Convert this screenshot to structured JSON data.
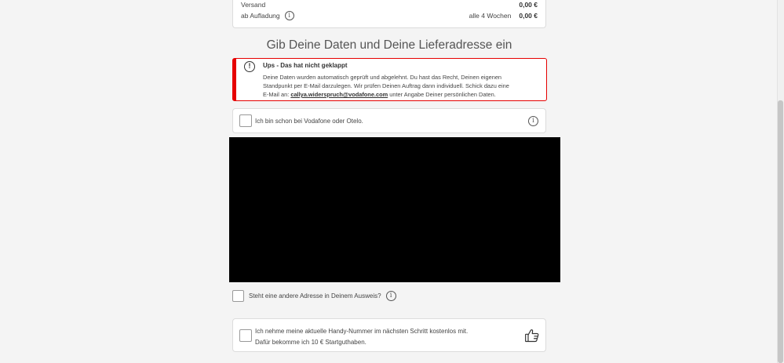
{
  "summary": {
    "shipping_label": "Versand",
    "shipping_value": "0,00 €",
    "topup_label": "ab Aufladung",
    "topup_period": "alle 4 Wochen",
    "topup_value": "0,00 €"
  },
  "page_title": "Gib Deine Daten und Deine Lieferadresse ein",
  "alert": {
    "title": "Ups - Das hat nicht geklappt",
    "body_part1": "Deine Daten wurden automatisch geprüft und abgelehnt. Du hast das Recht, Deinen eigenen Standpunkt per E-Mail darzulegen. Wir prüfen Deinen Auftrag dann individuell. Schick dazu eine E-Mail an: ",
    "email": "callya.widerspruch@vodafone.com",
    "body_part2": " unter Angabe Deiner persönlichen Daten.",
    "icon": "exclamation-icon",
    "accent_color": "#e60000"
  },
  "existing_customer": {
    "label": "Ich bin schon bei Vodafone oder Otelo."
  },
  "address": {
    "label": "Steht eine andere Adresse in Deinem Ausweis?"
  },
  "number_transfer": {
    "label": "Ich nehme meine aktuelle Handy-Nummer im nächsten Schritt kostenlos mit. Dafür bekomme ich 10 € Startguthaben.",
    "icon": "thumbs-up-icon"
  }
}
